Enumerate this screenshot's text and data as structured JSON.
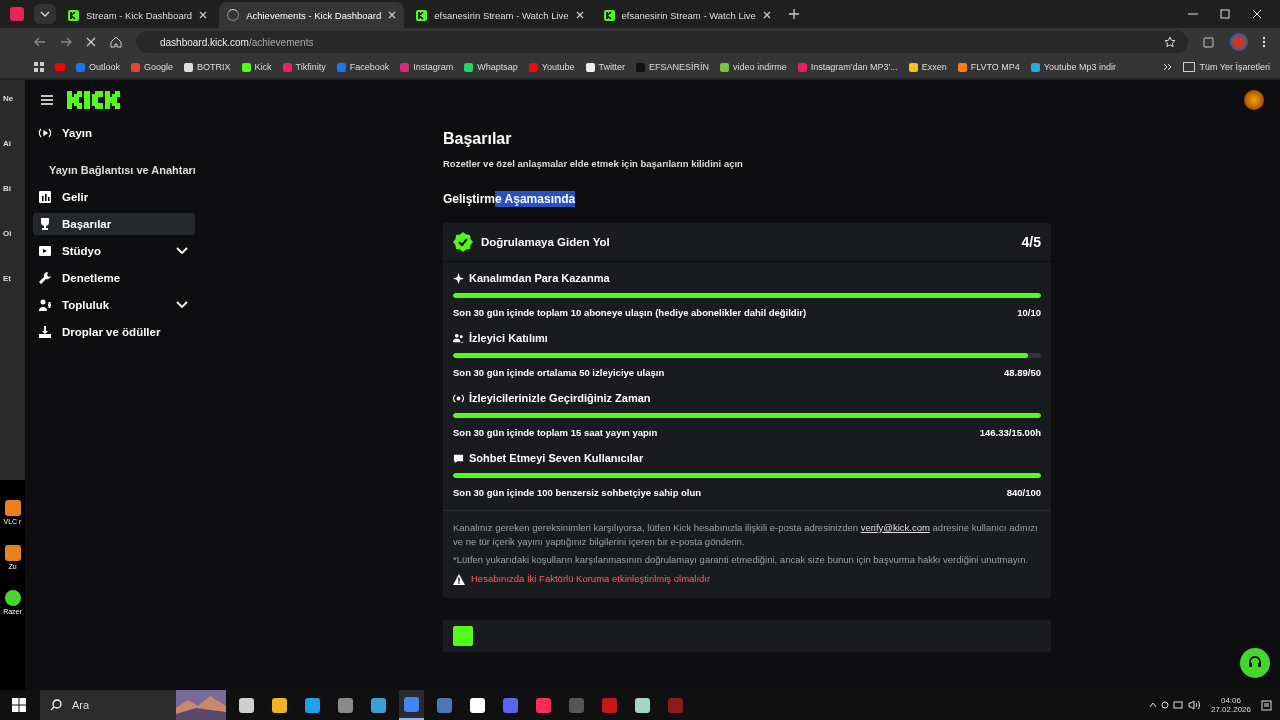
{
  "browser": {
    "tabs": [
      {
        "title": "Stream - Kick Dashboard",
        "selected": false,
        "loading": false
      },
      {
        "title": "Achievements - Kick Dashboard",
        "selected": true,
        "loading": true
      },
      {
        "title": "efsanesirin Stream - Watch Live",
        "selected": false,
        "loading": false
      },
      {
        "title": "efsanesirin Stream - Watch Live",
        "selected": false,
        "loading": false
      }
    ],
    "url_host": "dashboard.kick.com",
    "url_path": "/achievements",
    "bookmarks": [
      {
        "label": "Outlook",
        "color": "#1a73e8"
      },
      {
        "label": "Google",
        "color": "#ea4335"
      },
      {
        "label": "BOTRIX",
        "color": "#dddddd"
      },
      {
        "label": "Kick",
        "color": "#53fc18"
      },
      {
        "label": "Tikfinity",
        "color": "#e8245a"
      },
      {
        "label": "Facebook",
        "color": "#1877f2"
      },
      {
        "label": "Instagram",
        "color": "#d62976"
      },
      {
        "label": "Whaptsap",
        "color": "#25d366"
      },
      {
        "label": "Youtube",
        "color": "#ff0000"
      },
      {
        "label": "Twitter",
        "color": "#eeeeee"
      },
      {
        "label": "EFSANESİRİN",
        "color": "#111111"
      },
      {
        "label": "video indirme",
        "color": "#7cc242"
      },
      {
        "label": "Instagram'dan MP3'...",
        "color": "#e91e63"
      },
      {
        "label": "Exxen",
        "color": "#f5c518"
      },
      {
        "label": "FLVTO MP4",
        "color": "#ff7a1a"
      },
      {
        "label": "Youtube Mp3 indir",
        "color": "#2aa8e0"
      }
    ],
    "all_bookmarks": "Tüm Yer İşaretleri"
  },
  "desktop": {
    "behind_window_letters": [
      "Ne",
      "Ai",
      "Bi",
      "Oi",
      "Et"
    ],
    "icons": [
      {
        "label": "VLC r"
      },
      {
        "label": "Zu"
      },
      {
        "label": "Razer"
      }
    ]
  },
  "sidebar": {
    "items": [
      {
        "kind": "broadcast",
        "label": "Yayın",
        "selected": false,
        "expandable": false,
        "children": [
          {
            "label": "Yayın Bağlantısı ve Anahtarı",
            "selected": false
          }
        ]
      },
      {
        "kind": "chart",
        "label": "Gelir",
        "selected": false,
        "expandable": false
      },
      {
        "kind": "trophy",
        "label": "Başarılar",
        "selected": true,
        "expandable": false
      },
      {
        "kind": "studio",
        "label": "Stüdyo",
        "selected": false,
        "expandable": true
      },
      {
        "kind": "wrench",
        "label": "Denetleme",
        "selected": false,
        "expandable": false
      },
      {
        "kind": "users",
        "label": "Topluluk",
        "selected": false,
        "expandable": true
      },
      {
        "kind": "drops",
        "label": "Droplar ve ödüller",
        "selected": false,
        "expandable": false
      }
    ]
  },
  "page": {
    "title": "Başarılar",
    "subtitle": "Rozetler ve özel anlaşmalar elde etmek için başarıların kilidini açın",
    "section_title": "Geliştirm",
    "section_title_selected": "e Aşamasında",
    "card": {
      "title": "Doğrulamaya Giden Yol",
      "count": "4/5",
      "goals": [
        {
          "kind": "sparkle",
          "name": "Kanalımdan Para Kazanma",
          "level": 1,
          "description": "Son 30 gün içinde toplam 10 aboneye ulaşın (hediye abonelikler dahil değildir)",
          "progress": "10/10"
        },
        {
          "kind": "users",
          "name": "İzleyici Katılımı",
          "level": 0.978,
          "description": "Son 30 gün içinde ortalama 50 izleyiciye ulaşın",
          "progress": "48.89/50"
        },
        {
          "kind": "broadcast",
          "name": "İzleyicilerinizle Geçirdiğiniz Zaman",
          "level": 1,
          "description": "Son 30 gün içinde toplam 15 saat yayın yapın",
          "progress": "146.33/15.00h"
        },
        {
          "kind": "chat",
          "name": "Sohbet Etmeyi Seven Kullanıcılar",
          "level": 1,
          "description": "Son 30 gün içinde 100 benzersiz sohbetçiye sahip olun",
          "progress": "840/100"
        }
      ],
      "note_before": "Kanalınız gereken gereksinimleri karşılıyorsa, lütfen Kick hesabınızla ilişkili e-posta adresinizden ",
      "note_link": "verify@kick.com",
      "note_after": " adresine kullanıcı adınızı ve ne tür içerik yayını yaptığınız bilgilerini içeren bir e-posta gönderin.",
      "disclaimer": "*Lütfen yukarıdaki koşulların karşılanmasının doğrulamayı garanti etmediğini, ancak size bunun için başvurma hakkı verdiğini unutmayın.",
      "warning": "Hesabınızda İki Faktörlü Koruma etkinleştirilmiş olmalıdır"
    }
  },
  "taskbar": {
    "search_placeholder": "Ara",
    "apps": [
      {
        "color": "#cfcfcf",
        "selected": false
      },
      {
        "color": "#f0b429",
        "selected": false
      },
      {
        "color": "#1fa1e8",
        "selected": false
      },
      {
        "color": "#8a8a8a",
        "selected": false
      },
      {
        "color": "#3aa0d8",
        "selected": false
      },
      {
        "color": "#4285f4",
        "selected": true
      },
      {
        "color": "#4a78b0",
        "selected": false
      },
      {
        "color": "#ffffff",
        "selected": false
      },
      {
        "color": "#5865f2",
        "selected": false
      },
      {
        "color": "#fe2c55",
        "selected": false
      },
      {
        "color": "#555555",
        "selected": false
      },
      {
        "color": "#c4161c",
        "selected": false
      },
      {
        "color": "#9fd8c8",
        "selected": false
      },
      {
        "color": "#8b1a1a",
        "selected": false
      }
    ],
    "time": "04:06",
    "date": "27.02.2026"
  }
}
